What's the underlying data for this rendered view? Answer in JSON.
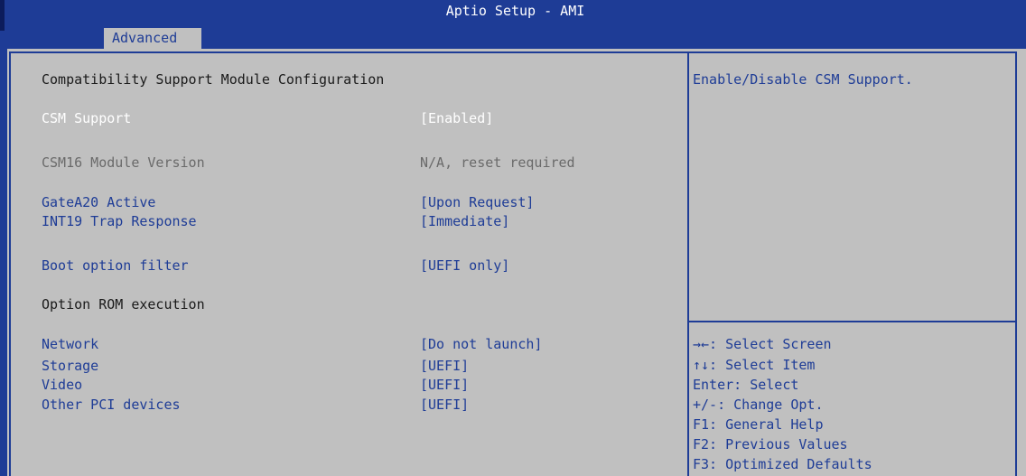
{
  "window": {
    "title": "Aptio Setup - AMI"
  },
  "tabs": [
    {
      "label": "Advanced",
      "active": true
    }
  ],
  "main": {
    "section_title": "Compatibility Support Module Configuration",
    "items": [
      {
        "label": "CSM Support",
        "value": "[Enabled]",
        "state": "selected"
      },
      {
        "label": "CSM16 Module Version",
        "value": "N/A, reset required",
        "state": "readonly"
      },
      {
        "label": "GateA20 Active",
        "value": "[Upon Request]",
        "state": "option"
      },
      {
        "label": "INT19 Trap Response",
        "value": "[Immediate]",
        "state": "option"
      },
      {
        "label": "Boot option filter",
        "value": "[UEFI only]",
        "state": "option"
      }
    ],
    "subsection_title": "Option ROM execution",
    "rom_items": [
      {
        "label": "Network",
        "value": "[Do not launch]"
      },
      {
        "label": "Storage",
        "value": "[UEFI]"
      },
      {
        "label": "Video",
        "value": "[UEFI]"
      },
      {
        "label": "Other PCI devices",
        "value": "[UEFI]"
      }
    ]
  },
  "help_panel": {
    "description": "Enable/Disable CSM Support.",
    "keys": [
      "→←: Select Screen",
      "↑↓: Select Item",
      "Enter: Select",
      "+/-: Change Opt.",
      "F1: General Help",
      "F2: Previous Values",
      "F3: Optimized Defaults"
    ]
  },
  "colors": {
    "bios_blue": "#1e3c96",
    "panel_grey": "#c0c0c0",
    "selected_text": "#ffffff",
    "disabled_text": "#6a6a6a"
  }
}
